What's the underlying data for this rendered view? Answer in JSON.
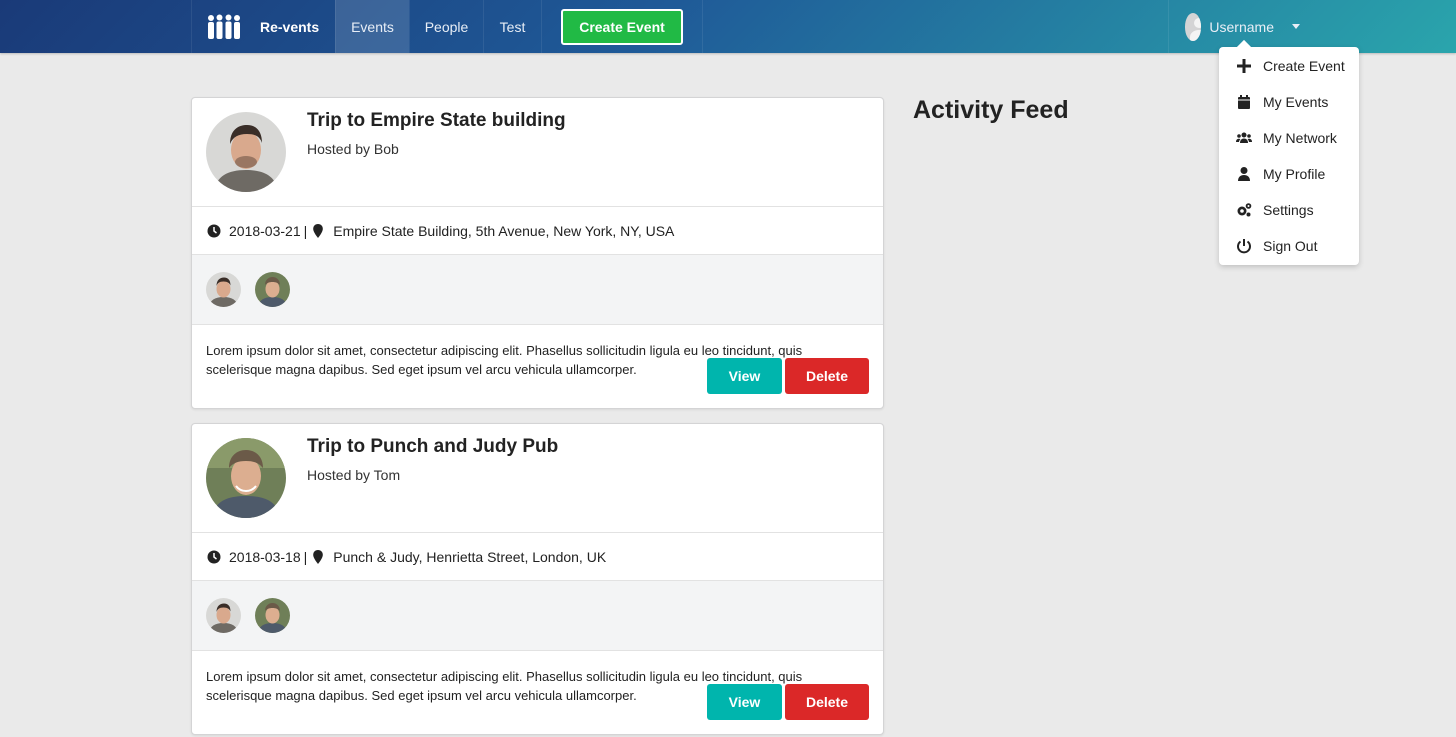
{
  "navbar": {
    "brand": "Re-vents",
    "items": [
      {
        "label": "Events",
        "active": true
      },
      {
        "label": "People",
        "active": false
      },
      {
        "label": "Test",
        "active": false
      }
    ],
    "create_button": "Create Event",
    "username": "Username"
  },
  "dropdown": {
    "items": [
      {
        "label": "Create Event",
        "icon": "plus-icon"
      },
      {
        "label": "My Events",
        "icon": "calendar-icon"
      },
      {
        "label": "My Network",
        "icon": "users-icon"
      },
      {
        "label": "My Profile",
        "icon": "user-icon"
      },
      {
        "label": "Settings",
        "icon": "gears-icon"
      },
      {
        "label": "Sign Out",
        "icon": "power-icon"
      }
    ]
  },
  "events": [
    {
      "title": "Trip to Empire State building",
      "hosted_by": "Hosted by Bob",
      "date": "2018-03-21",
      "separator": "|",
      "venue": "Empire State Building, 5th Avenue, New York, NY, USA",
      "description": "Lorem ipsum dolor sit amet, consectetur adipiscing elit. Phasellus sollicitudin ligula eu leo tincidunt, quis scelerisque magna dapibus. Sed eget ipsum vel arcu vehicula ullamcorper.",
      "view_label": "View",
      "delete_label": "Delete"
    },
    {
      "title": "Trip to Punch and Judy Pub",
      "hosted_by": "Hosted by Tom",
      "date": "2018-03-18",
      "separator": "|",
      "venue": "Punch & Judy, Henrietta Street, London, UK",
      "description": "Lorem ipsum dolor sit amet, consectetur adipiscing elit. Phasellus sollicitudin ligula eu leo tincidunt, quis scelerisque magna dapibus. Sed eget ipsum vel arcu vehicula ullamcorper.",
      "view_label": "View",
      "delete_label": "Delete"
    }
  ],
  "activity_feed": {
    "title": "Activity Feed"
  },
  "colors": {
    "create_button": "#21ba45",
    "view_button": "#00b5ad",
    "delete_button": "#db2828"
  }
}
